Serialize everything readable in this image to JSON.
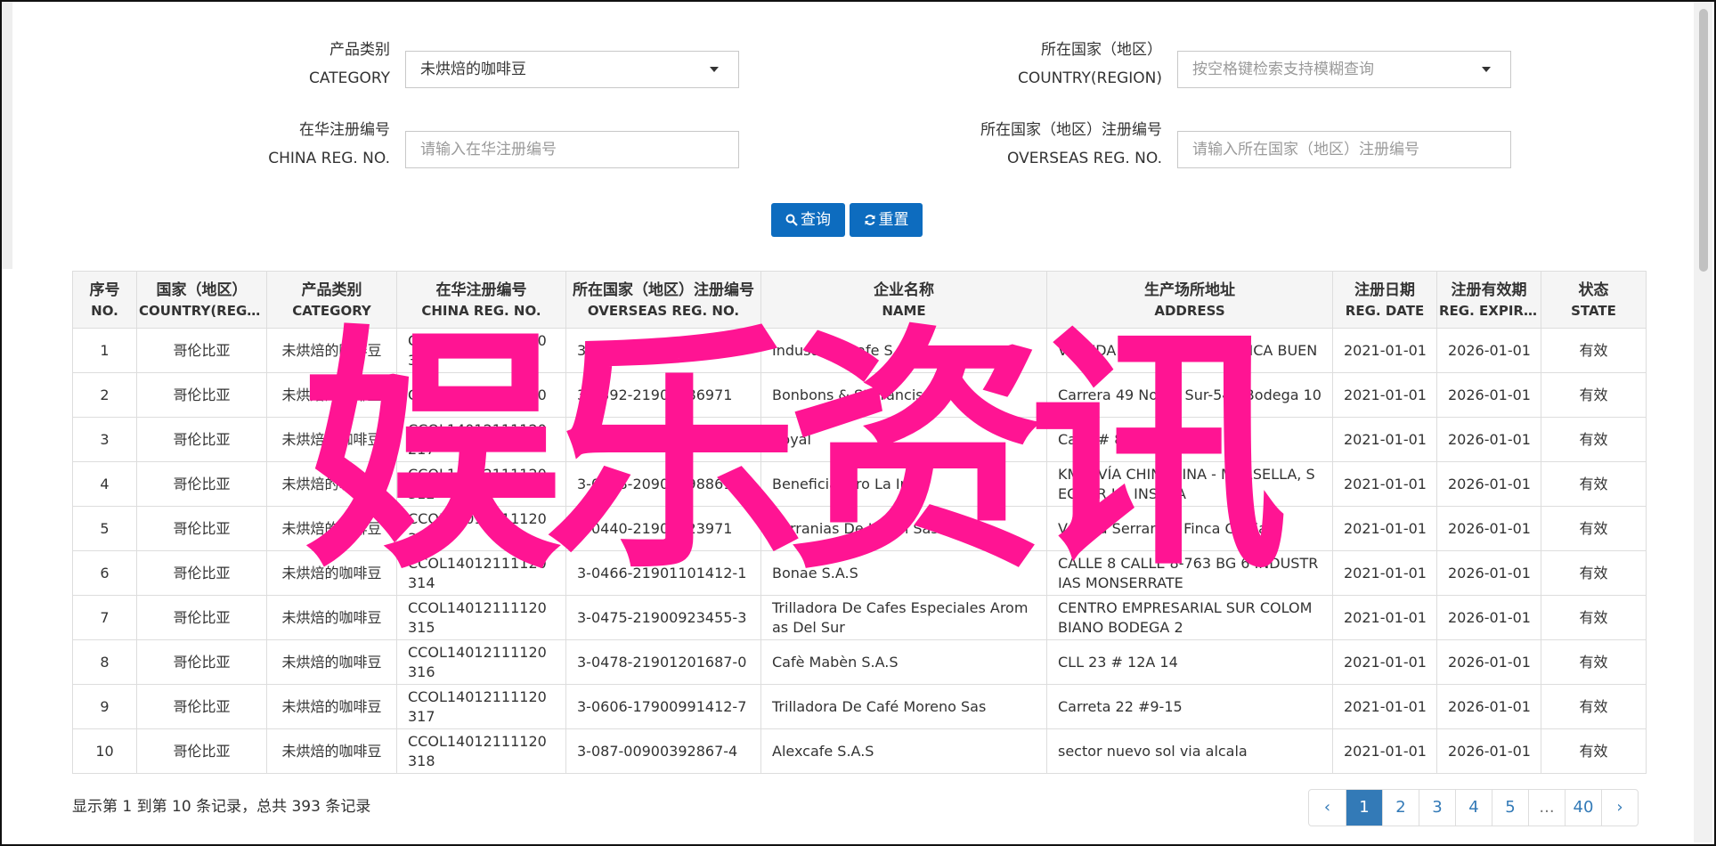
{
  "filters": {
    "category_label": "产品类别",
    "category_label_en": "CATEGORY",
    "category_value": "未烘焙的咖啡豆",
    "country_label": "所在国家（地区）",
    "country_label_en": "COUNTRY(REGION)",
    "country_placeholder": "按空格键检索支持模糊查询",
    "china_reg_label": "在华注册编号",
    "china_reg_label_en": "CHINA REG. NO.",
    "china_reg_placeholder": "请输入在华注册编号",
    "overseas_reg_label": "所在国家（地区）注册编号",
    "overseas_reg_label_en": "OVERSEAS REG. NO.",
    "overseas_reg_placeholder": "请输入所在国家（地区）注册编号",
    "query_label": "查询",
    "reset_label": "重置"
  },
  "table": {
    "headers": [
      {
        "zh": "序号",
        "en": "NO."
      },
      {
        "zh": "国家（地区）",
        "en": "COUNTRY(REGIO..."
      },
      {
        "zh": "产品类别",
        "en": "CATEGORY"
      },
      {
        "zh": "在华注册编号",
        "en": "CHINA REG. NO."
      },
      {
        "zh": "所在国家（地区）注册编号",
        "en": "OVERSEAS REG. NO."
      },
      {
        "zh": "企业名称",
        "en": "NAME"
      },
      {
        "zh": "生产场所地址",
        "en": "ADDRESS"
      },
      {
        "zh": "注册日期",
        "en": "REG. DATE"
      },
      {
        "zh": "注册有效期",
        "en": "REG. EXPIRE ..."
      },
      {
        "zh": "状态",
        "en": "STATE"
      }
    ],
    "rows": [
      [
        "1",
        "哥伦比亚",
        "未烘焙的咖啡豆",
        "CCOL14012111120310",
        "3-0390-",
        "Industrias Cafe S.A.S.",
        "VEREDA PATIO BONITO, FINCA BUEN",
        "2021-01-01",
        "2026-01-01",
        "有效"
      ],
      [
        "2",
        "哥伦比亚",
        "未烘焙的咖啡豆",
        "CCOL14012111120",
        "3-0392-21900586971",
        "Bonbons & St Francis S.A.S.",
        "Carrera 49 No 61 Sur-540 Bodega 10",
        "2021-01-01",
        "2026-01-01",
        "有效"
      ],
      [
        "3",
        "哥伦比亚",
        "未烘焙的咖啡豆",
        "CCOL14012111120217",
        "3-011",
        "Royal",
        "Calle # 8 - 28",
        "2021-01-01",
        "2026-01-01",
        "有效"
      ],
      [
        "4",
        "哥伦比亚",
        "未烘焙的咖啡豆",
        "CCOL14012111120312",
        "3-0428-20900298861",
        "Beneficiadero La In",
        "KM 7 VÍA CHINCHINA - MARSELLA, SECTOR LA INSULA",
        "2021-01-01",
        "2026-01-01",
        "有效"
      ],
      [
        "5",
        "哥伦比亚",
        "未烘焙的咖啡豆",
        "CCOL14012111120313",
        "3-0440-21901323971",
        "Serranias De Jardin Sas",
        "Vereda Serranias Finca Gloria",
        "2021-01-01",
        "2026-01-01",
        "有效"
      ],
      [
        "6",
        "哥伦比亚",
        "未烘焙的咖啡豆",
        "CCOL14012111120314",
        "3-0466-21901101412-1",
        "Bonae S.A.S",
        "CALLE 8 CALLE 8-763 BG 6 INDUSTRIAS MONSERRATE",
        "2021-01-01",
        "2026-01-01",
        "有效"
      ],
      [
        "7",
        "哥伦比亚",
        "未烘焙的咖啡豆",
        "CCOL14012111120315",
        "3-0475-21900923455-3",
        "Trilladora De Cafes Especiales Aromas Del Sur",
        "CENTRO EMPRESARIAL SUR COLOMBIANO BODEGA 2",
        "2021-01-01",
        "2026-01-01",
        "有效"
      ],
      [
        "8",
        "哥伦比亚",
        "未烘焙的咖啡豆",
        "CCOL14012111120316",
        "3-0478-21901201687-0",
        "Cafè Mabèn S.A.S",
        "CLL 23 # 12A 14",
        "2021-01-01",
        "2026-01-01",
        "有效"
      ],
      [
        "9",
        "哥伦比亚",
        "未烘焙的咖啡豆",
        "CCOL14012111120317",
        "3-0606-17900991412-7",
        "Trilladora De Café Moreno Sas",
        "Carreta 22 #9-15",
        "2021-01-01",
        "2026-01-01",
        "有效"
      ],
      [
        "10",
        "哥伦比亚",
        "未烘焙的咖啡豆",
        "CCOL14012111120318",
        "3-087-00900392867-4",
        "Alexcafe S.A.S",
        "sector nuevo sol via alcala",
        "2021-01-01",
        "2026-01-01",
        "有效"
      ]
    ]
  },
  "footer": {
    "info": "显示第 1 到第 10 条记录，总共 393 条记录",
    "pages": [
      "‹",
      "1",
      "2",
      "3",
      "4",
      "5",
      "...",
      "40",
      "›"
    ],
    "active_page": "1"
  },
  "watermark": {
    "text": "娱乐资讯",
    "color": "#ff1493"
  },
  "colors": {
    "primary": "#0d6cbf",
    "pager": "#337ab7"
  }
}
